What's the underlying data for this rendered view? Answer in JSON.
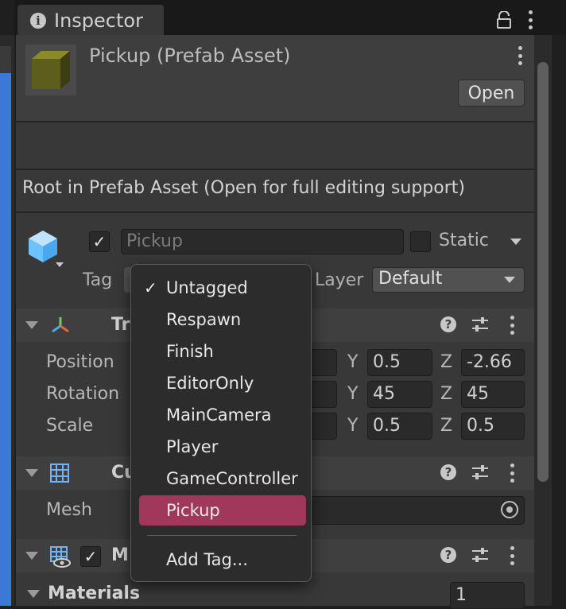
{
  "tab": {
    "title": "Inspector"
  },
  "header": {
    "asset_title": "Pickup (Prefab Asset)",
    "open_label": "Open"
  },
  "notice": "Root in Prefab Asset (Open for full editing support)",
  "gameobject": {
    "active": true,
    "name": "Pickup",
    "static_label": "Static",
    "tag_label": "Tag",
    "layer_label": "Layer",
    "layer_value": "Default"
  },
  "transform": {
    "title_partial": "Tr",
    "rows": [
      {
        "label": "Position",
        "y": "0.5",
        "z": "-2.66"
      },
      {
        "label": "Rotation",
        "y": "45",
        "z": "45"
      },
      {
        "label": "Scale",
        "y": "0.5",
        "z": "0.5"
      }
    ],
    "axis_y": "Y",
    "axis_z": "Z"
  },
  "mesh_filter": {
    "title_partial": "Cu",
    "mesh_label": "Mesh"
  },
  "mesh_renderer": {
    "title_partial": "M",
    "enabled": true
  },
  "materials": {
    "label": "Materials",
    "count": "1"
  },
  "tag_dropdown": {
    "check_glyph": "✓",
    "items": [
      "Untagged",
      "Respawn",
      "Finish",
      "EditorOnly",
      "MainCamera",
      "Player",
      "GameController",
      "Pickup"
    ],
    "checked_item": "Untagged",
    "highlighted_item": "Pickup",
    "add_tag_label": "Add Tag..."
  },
  "colors": {
    "panel_bg": "#383838",
    "highlight": "#a0385c",
    "accent_blue": "#3c78d8"
  }
}
